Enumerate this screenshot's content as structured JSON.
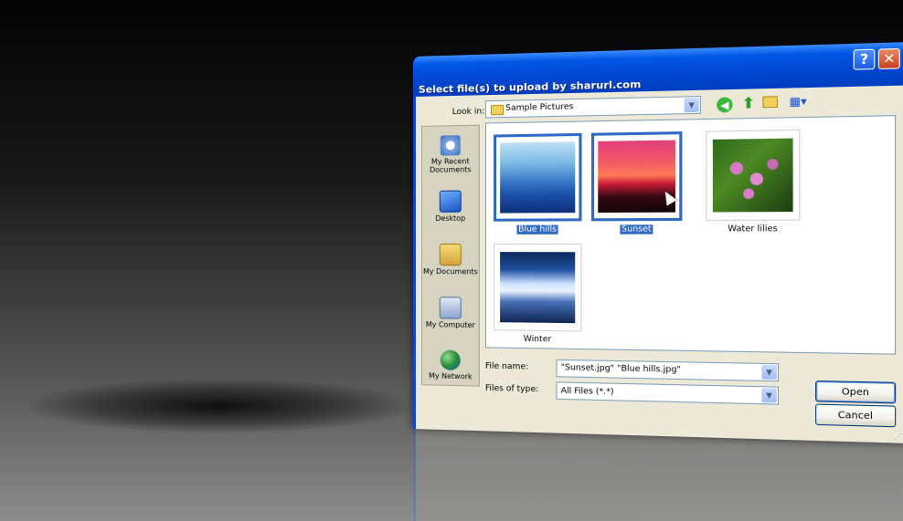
{
  "dialog": {
    "title": "Select file(s) to upload by sharurl.com",
    "help_glyph": "?",
    "close_glyph": "✕"
  },
  "toolbar": {
    "look_in_label": "Look in:",
    "look_in_value": "Sample Pictures",
    "combo_arrow": "▼",
    "icons": {
      "back": "back-icon",
      "up": "up-folder-icon",
      "new_folder": "new-folder-icon",
      "views": "views-menu-icon"
    },
    "back_glyph": "◀",
    "up_glyph": "⬆",
    "views_glyph": "▦▾"
  },
  "places": [
    {
      "label": "My Recent Documents",
      "icon": "recent-documents-icon"
    },
    {
      "label": "Desktop",
      "icon": "desktop-icon"
    },
    {
      "label": "My Documents",
      "icon": "my-documents-icon"
    },
    {
      "label": "My Computer",
      "icon": "my-computer-icon"
    },
    {
      "label": "My Network",
      "icon": "my-network-icon"
    }
  ],
  "files": [
    {
      "name": "Blue hills",
      "selected": true
    },
    {
      "name": "Sunset",
      "selected": true
    },
    {
      "name": "Water lilies",
      "selected": false
    },
    {
      "name": "Winter",
      "selected": false
    }
  ],
  "form": {
    "file_name_label": "File name:",
    "file_name_value": "\"Sunset.jpg\" \"Blue hills.jpg\"",
    "file_type_label": "Files of type:",
    "file_type_value": "All Files (*.*)"
  },
  "buttons": {
    "open": "Open",
    "cancel": "Cancel"
  },
  "colors": {
    "title_bar": "#0047d0",
    "selection": "#316ac5",
    "dialog_face": "#ece9d8"
  }
}
